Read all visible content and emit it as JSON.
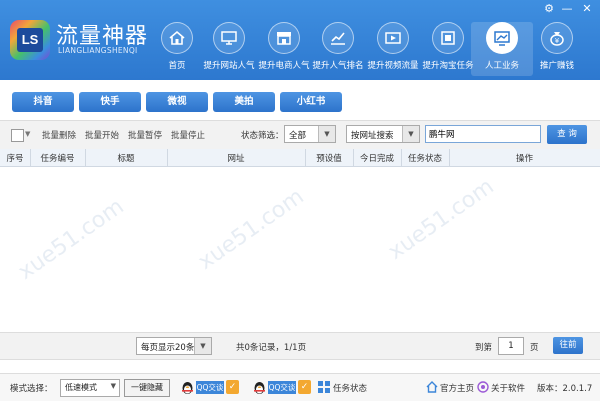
{
  "app": {
    "title": "流量神器",
    "subtitle": "LIANGLIANGSHENQI",
    "logo_text": "LS"
  },
  "window_controls": {
    "settings": "⚙",
    "minimize": "—",
    "close": "✕"
  },
  "nav": [
    {
      "label": "首页",
      "icon": "home-icon"
    },
    {
      "label": "提升网站人气",
      "icon": "monitor-icon"
    },
    {
      "label": "提升电商人气",
      "icon": "storefront-icon"
    },
    {
      "label": "提升人气排名",
      "icon": "ranking-chart-icon"
    },
    {
      "label": "提升视频流量",
      "icon": "video-play-icon"
    },
    {
      "label": "提升淘宝任务",
      "icon": "taobao-icon"
    },
    {
      "label": "人工业务",
      "icon": "manual-service-icon",
      "active": true
    },
    {
      "label": "推广赚钱",
      "icon": "money-bag-icon"
    }
  ],
  "platforms": [
    "抖音",
    "快手",
    "微视",
    "美拍",
    "小红书"
  ],
  "toolbar": {
    "batch_delete": "批量删除",
    "batch_start": "批量开始",
    "batch_pause": "批量暂停",
    "batch_stop": "批量停止",
    "status_filter_label": "状态筛选：",
    "status_filter_value": "全部",
    "search_type": "按网址搜索",
    "search_value": "鹏牛网",
    "query_button": "查 询"
  },
  "table": {
    "columns": [
      "序号",
      "任务编号",
      "标题",
      "网址",
      "预设值",
      "今日完成",
      "任务状态",
      "操作"
    ],
    "rows": []
  },
  "watermark": "xue51.com",
  "pager": {
    "per_page": "每页显示20条",
    "summary": "共0条记录，1/1页",
    "goto_prefix": "到第",
    "page_value": "1",
    "goto_suffix": "页",
    "goto_button": "往前"
  },
  "statusbar": {
    "mode_label": "模式选择：",
    "mode_value": "低速模式",
    "hide_button": "一键隐藏",
    "qq1": "QQ交谈",
    "qq2": "QQ交谈",
    "task_status": "任务状态",
    "homepage": "官方主页",
    "about": "关于软件",
    "version": "版本：2.0.1.7"
  },
  "colors": {
    "header": "#2d78cf",
    "button": "#3b84d8",
    "accent": "#f3a830"
  }
}
